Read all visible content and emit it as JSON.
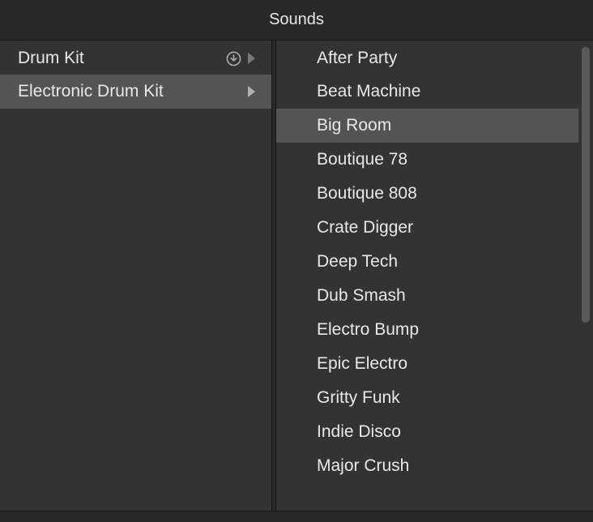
{
  "header": {
    "title": "Sounds"
  },
  "left": {
    "items": [
      {
        "label": "Drum Kit",
        "selected": false,
        "has_download": true
      },
      {
        "label": "Electronic Drum Kit",
        "selected": true,
        "has_download": false
      }
    ]
  },
  "right": {
    "items": [
      {
        "label": "After Party",
        "selected": false
      },
      {
        "label": "Beat Machine",
        "selected": false
      },
      {
        "label": "Big Room",
        "selected": true
      },
      {
        "label": "Boutique 78",
        "selected": false
      },
      {
        "label": "Boutique 808",
        "selected": false
      },
      {
        "label": "Crate Digger",
        "selected": false
      },
      {
        "label": "Deep Tech",
        "selected": false
      },
      {
        "label": "Dub Smash",
        "selected": false
      },
      {
        "label": "Electro Bump",
        "selected": false
      },
      {
        "label": "Epic Electro",
        "selected": false
      },
      {
        "label": "Gritty Funk",
        "selected": false
      },
      {
        "label": "Indie Disco",
        "selected": false
      },
      {
        "label": "Major Crush",
        "selected": false
      }
    ]
  }
}
